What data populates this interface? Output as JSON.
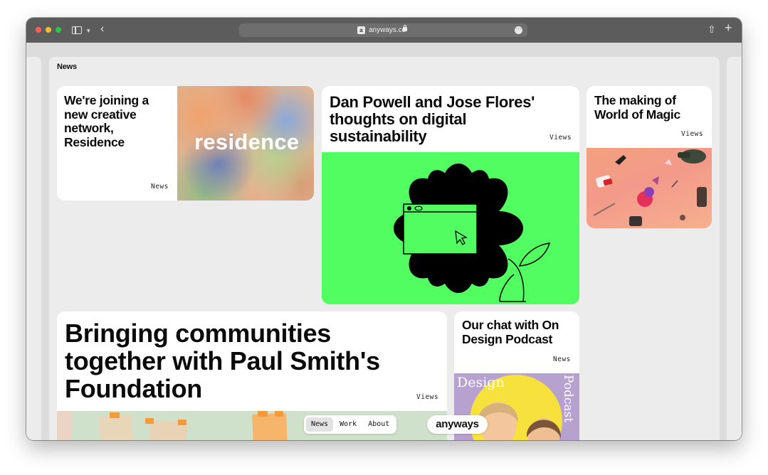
{
  "browser": {
    "url": "anyways.co",
    "favicon_letter": "a"
  },
  "page": {
    "title": "News"
  },
  "cards": [
    {
      "title": "We're joining a new creative network, Residence",
      "tag": "News",
      "image_text": "residence"
    },
    {
      "title": "Dan Powell and Jose Flores' thoughts on digital sustainability",
      "tag": "Views"
    },
    {
      "title": "The making of World of Magic",
      "tag": "Views"
    },
    {
      "title": "Bringing communities together with Paul Smith's Foundation",
      "tag": "Views"
    },
    {
      "title": "Our chat with On Design Podcast",
      "tag": "News",
      "image_text_left": "Design",
      "image_text_right": "Podcast"
    }
  ],
  "nav": {
    "items": [
      "News",
      "Work",
      "About"
    ],
    "active": "News",
    "brand": "anyways"
  },
  "colors": {
    "titlebar": "#5c5c5c",
    "page_bg": "#ececec",
    "green_accent": "#52fd61",
    "podcast_purple": "#b7a2cf",
    "podcast_yellow": "#f7e23d"
  }
}
